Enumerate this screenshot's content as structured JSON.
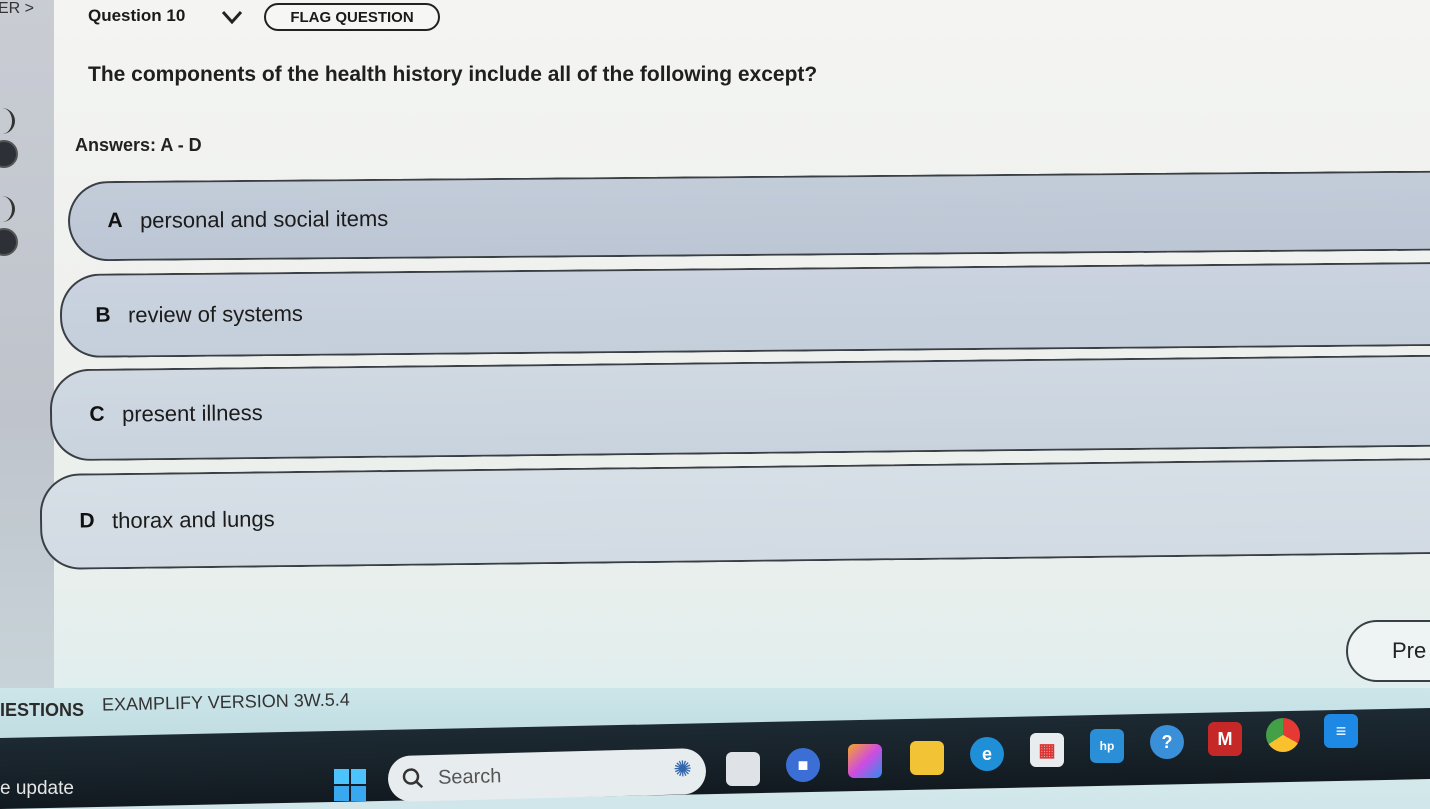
{
  "sidebar": {
    "crumb": "ER >"
  },
  "header": {
    "question_label": "Question 10",
    "flag_label": "FLAG QUESTION"
  },
  "question": {
    "text": "The components of the health history include all of the following except?",
    "answers_range": "Answers: A - D"
  },
  "answers": [
    {
      "letter": "A",
      "text": "personal and social items"
    },
    {
      "letter": "B",
      "text": "review of systems"
    },
    {
      "letter": "C",
      "text": "present illness"
    },
    {
      "letter": "D",
      "text": "thorax and lungs"
    }
  ],
  "nav": {
    "prev_label": "Pre"
  },
  "footer": {
    "questions_label": "IESTIONS",
    "version": "EXAMPLIFY VERSION 3W.5.4"
  },
  "taskbar": {
    "update_text": "e update",
    "search_placeholder": "Search",
    "icons": [
      "windows-start-icon",
      "task-view-icon",
      "meet-icon",
      "copilot-icon",
      "file-explorer-icon",
      "edge-icon",
      "store-icon",
      "hp-icon",
      "help-icon",
      "mcafee-icon",
      "chrome-icon",
      "app-icon"
    ]
  }
}
